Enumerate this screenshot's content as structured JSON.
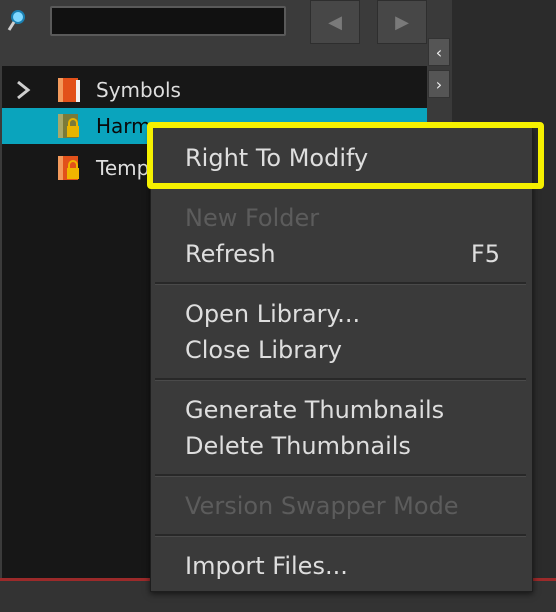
{
  "toolbar": {
    "search_value": "",
    "icons": [
      "search-icon",
      "back-arrow-icon",
      "forward-arrow-icon"
    ]
  },
  "side_buttons": {
    "collapse_left": "‹",
    "collapse_right": "›"
  },
  "tree": {
    "items": [
      {
        "label": "Symbols",
        "icon": "library-book-icon",
        "selected": false
      },
      {
        "label": "Harm",
        "icon": "locked-library-icon",
        "selected": true
      },
      {
        "label": "Temp",
        "icon": "locked-library-icon",
        "selected": false
      }
    ]
  },
  "context_menu": {
    "items": [
      {
        "label": "Right To Modify",
        "enabled": true,
        "highlighted": true
      },
      {
        "label": "New Folder",
        "enabled": false
      },
      {
        "label": "Refresh",
        "enabled": true,
        "shortcut": "F5"
      },
      {
        "label": "Open Library...",
        "enabled": true
      },
      {
        "label": "Close Library",
        "enabled": true
      },
      {
        "label": "Generate Thumbnails",
        "enabled": true
      },
      {
        "label": "Delete Thumbnails",
        "enabled": true
      },
      {
        "label": "Version Swapper Mode",
        "enabled": false
      },
      {
        "label": "Import Files...",
        "enabled": true
      }
    ]
  },
  "colors": {
    "selection": "#0aa4bd",
    "highlight_box": "#f5f000",
    "accent_bar": "#9c2a2a"
  }
}
